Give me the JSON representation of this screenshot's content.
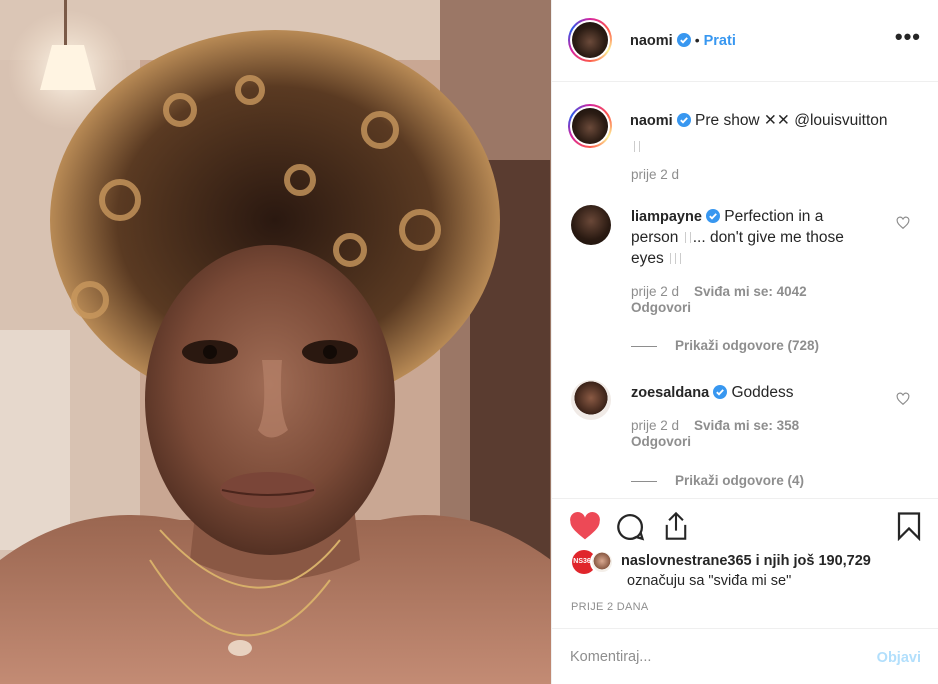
{
  "header": {
    "username": "naomi",
    "separator": "•",
    "follow_label": "Prati",
    "more_icon": "more-dots-icon"
  },
  "caption": {
    "username": "naomi",
    "text": "Pre show ✕✕ @louisvuitton",
    "time": "prije 2 d"
  },
  "comments": [
    {
      "username": "liampayne",
      "line1": "Perfection in a",
      "line2": "person",
      "line2b": "... don't give me those",
      "line3": "eyes",
      "time": "prije 2 d",
      "likes": "Sviđa mi se: 4042",
      "reply": "Odgovori",
      "view_replies": "Prikaži odgovore (728)"
    },
    {
      "username": "zoesaldana",
      "line1": "Goddess",
      "time": "prije 2 d",
      "likes": "Sviđa mi se: 358",
      "reply": "Odgovori",
      "view_replies": "Prikaži odgovore (4)"
    }
  ],
  "likes": {
    "badge": "NS365",
    "user": "naslovnestrane365",
    "and_others": "i njih još",
    "count": "190,729",
    "suffix": "označuju sa \"sviđa mi se\""
  },
  "post_time": "PRIJE 2 DANA",
  "composer": {
    "placeholder": "Komentiraj...",
    "post_label": "Objavi"
  },
  "colors": {
    "accent": "#3897f0",
    "like_red": "#ed4956",
    "muted": "#8e8e8e",
    "post_disabled": "#b2dffc"
  }
}
